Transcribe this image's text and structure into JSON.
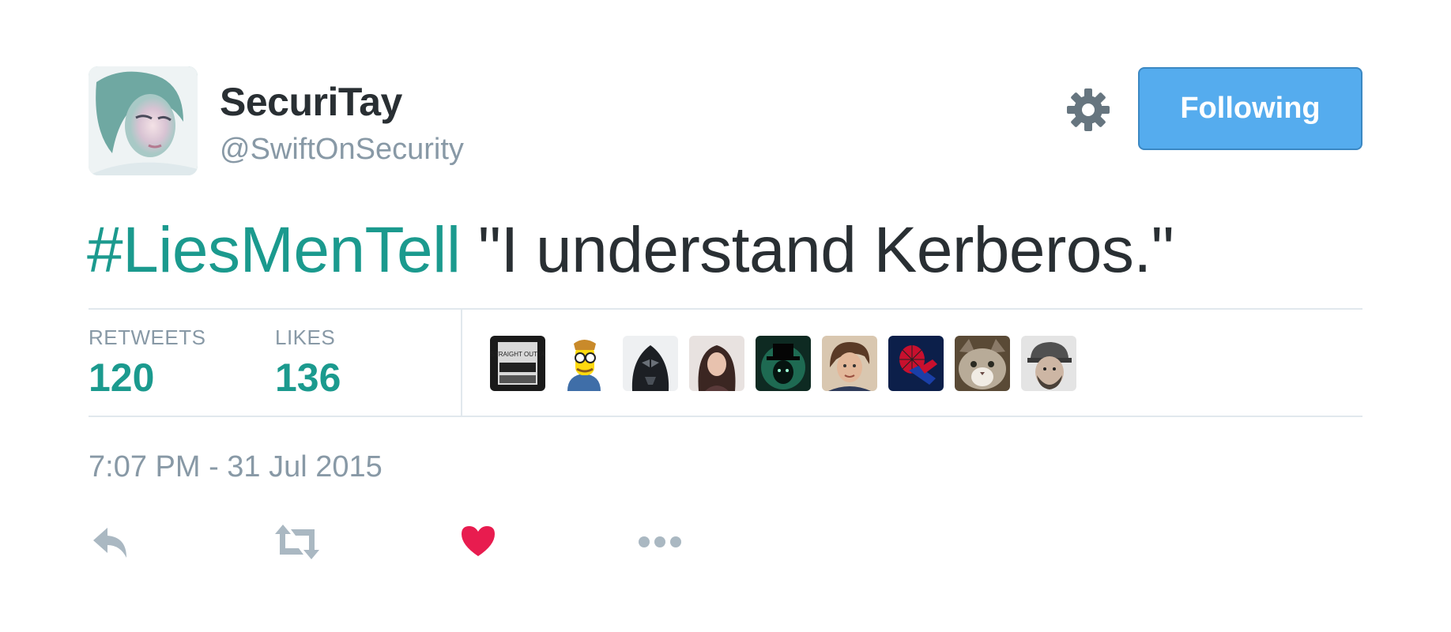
{
  "user": {
    "display_name": "SecuriTay",
    "handle": "@SwiftOnSecurity"
  },
  "follow_button": {
    "label": "Following"
  },
  "tweet": {
    "hashtag": "#LiesMenTell",
    "text": " \"I understand Kerberos.\""
  },
  "stats": {
    "retweets_label": "RETWEETS",
    "retweets_count": "120",
    "likes_label": "LIKES",
    "likes_count": "136"
  },
  "likers_banner_text": "STRAIGHT OUTTA",
  "timestamp": "7:07 PM - 31 Jul 2015",
  "icons": {
    "gear": "gear-icon",
    "reply": "reply-icon",
    "retweet": "retweet-icon",
    "like": "heart-icon",
    "more": "more-icon"
  },
  "colors": {
    "hashtag": "#1b9a8e",
    "follow_button": "#55acee",
    "like_heart": "#e81c4f",
    "muted": "#8899a6"
  }
}
